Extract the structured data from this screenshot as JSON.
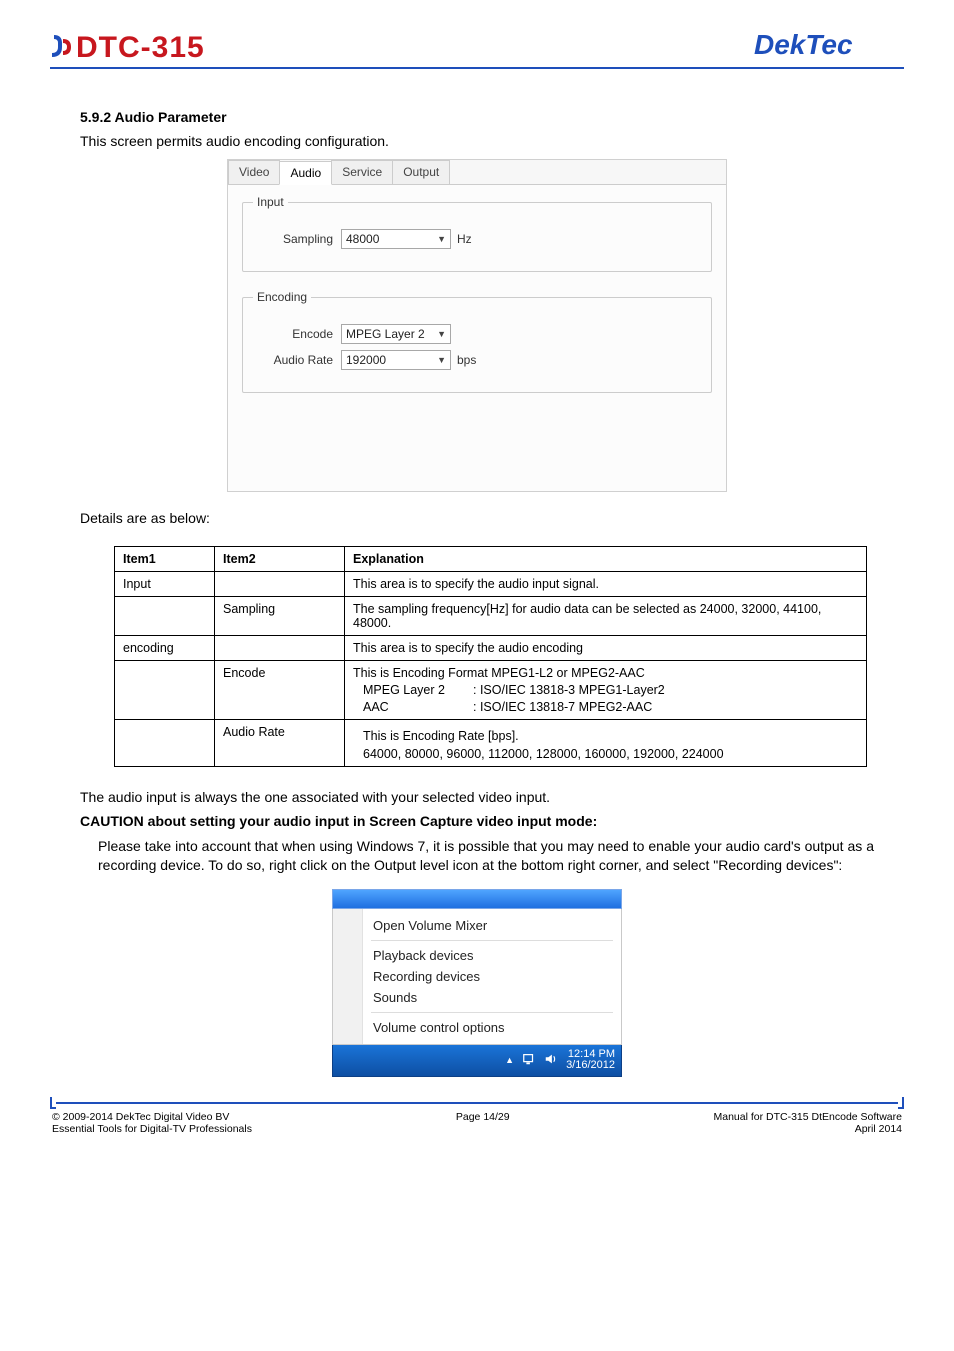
{
  "header": {
    "product": "DTC-315",
    "brand": "DekTec"
  },
  "section": {
    "number": "5.9.2",
    "title": "Audio Parameter",
    "intro": "This screen permits audio encoding configuration."
  },
  "panel": {
    "tabs": [
      "Video",
      "Audio",
      "Service",
      "Output"
    ],
    "active_tab": 1,
    "groups": {
      "input": {
        "legend": "Input",
        "sampling_label": "Sampling",
        "sampling_value": "48000",
        "sampling_unit": "Hz"
      },
      "encoding": {
        "legend": "Encoding",
        "encode_label": "Encode",
        "encode_value": "MPEG Layer 2",
        "rate_label": "Audio Rate",
        "rate_value": "192000",
        "rate_unit": "bps"
      }
    }
  },
  "details_lead": "Details are as below:",
  "table": {
    "headers": [
      "Item1",
      "Item2",
      "Explanation"
    ],
    "rows": [
      {
        "c1": "Input",
        "c2": "",
        "c3": "This area is to specify the audio input signal."
      },
      {
        "c1": "",
        "c2": "Sampling",
        "c3": "The sampling frequency[Hz] for audio data can be selected as 24000, 32000, 44100, 48000."
      },
      {
        "c1": "encoding",
        "c2": "",
        "c3": "This area is to specify the audio encoding"
      },
      {
        "c1": "",
        "c2": "Encode",
        "c3_line1": "This is Encoding Format MPEG1-L2 or MPEG2-AAC",
        "c3_pairs": [
          {
            "k": "MPEG Layer 2",
            "v": ": ISO/IEC 13818-3  MPEG1-Layer2"
          },
          {
            "k": "AAC",
            "v": ": ISO/IEC 13818-7  MPEG2-AAC"
          }
        ]
      },
      {
        "c1": "",
        "c2": "Audio Rate",
        "c3_line1": "This is Encoding Rate [bps].",
        "c3_line2": "64000, 80000, 96000, 112000, 128000, 160000, 192000, 224000"
      }
    ]
  },
  "after_table": {
    "p1": "The audio input is always the one associated with your selected video input.",
    "caution": "CAUTION about setting your audio input in Screen Capture video input mode:",
    "p2": "Please take into account that when using Windows 7, it is possible that you may need to enable your audio card's output as a recording device. To do so, right click on the Output level icon at the bottom right corner, and select \"Recording devices\":"
  },
  "context_menu": {
    "items": [
      "Open Volume Mixer",
      "Playback devices",
      "Recording devices",
      "Sounds",
      "Volume control options"
    ],
    "clock_time": "12:14 PM",
    "clock_date": "3/16/2012"
  },
  "footer": {
    "left1": "© 2009-2014 DekTec Digital Video BV",
    "left2": "Essential Tools for Digital-TV Professionals",
    "center": "Page 14/29",
    "right1": "Manual for DTC-315 DtEncode Software",
    "right2": "April 2014"
  }
}
